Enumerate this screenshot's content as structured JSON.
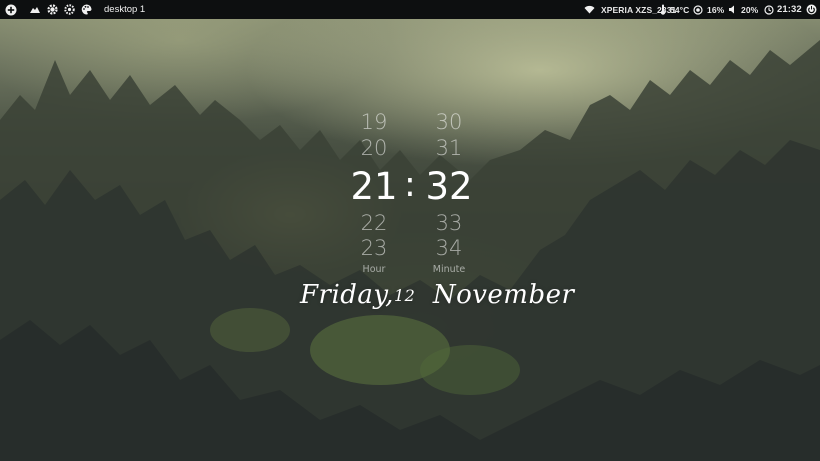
{
  "topbar": {
    "workspace_label": "desktop 1",
    "left_icons": [
      "plus-circle-icon",
      "cloud-icon",
      "settings-icon",
      "gear-icon",
      "palette-icon"
    ],
    "network_name": "XPERIA XZS_2331",
    "temperature": "54°C",
    "cpu": "16%",
    "volume": "20%",
    "time": "21:32",
    "right_icons": [
      "wifi-icon",
      "thermometer-icon",
      "cpu-icon",
      "volume-icon",
      "clock-icon",
      "power-icon"
    ]
  },
  "clock": {
    "hours": {
      "prev2": "19",
      "prev1": "20",
      "current": "21",
      "next1": "22",
      "next2": "23",
      "label": "Hour"
    },
    "minutes": {
      "prev2": "30",
      "prev1": "31",
      "current": "32",
      "next1": "33",
      "next2": "34",
      "label": "Minute"
    },
    "separator": ":"
  },
  "date": {
    "weekday": "Friday,",
    "day": "12",
    "month": "November"
  },
  "colors": {
    "bar_bg": "#0d0f10",
    "text": "#ffffff",
    "dim_text": "rgba(255,255,255,0.55)"
  }
}
